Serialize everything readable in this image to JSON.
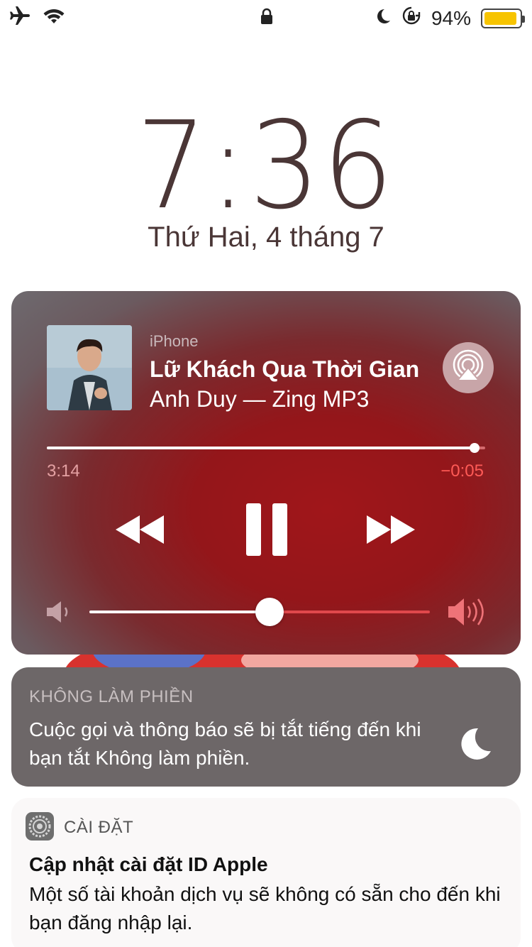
{
  "status_bar": {
    "icons": [
      "airplane-icon",
      "wifi-icon",
      "lock-icon",
      "moon-icon",
      "rotation-lock-icon"
    ],
    "battery_percent": "94%",
    "battery_level": 0.94,
    "battery_color": "#f7c400"
  },
  "lock_screen": {
    "time": "7:36",
    "date": "Thứ Hai, 4 tháng 7"
  },
  "now_playing": {
    "source": "iPhone",
    "title": "Lữ Khách Qua Thời Gian",
    "artist_line": "Anh Duy — Zing MP3",
    "elapsed": "3:14",
    "remaining": "−0:05",
    "progress": 0.975,
    "volume": 0.53,
    "accent_color": "#9b1418",
    "controls": [
      "rewind-icon",
      "pause-icon",
      "fast-forward-icon"
    ],
    "airplay_icon": "airplay-icon"
  },
  "do_not_disturb": {
    "header": "KHÔNG LÀM PHIỀN",
    "message": "Cuộc gọi và thông báo sẽ bị tắt tiếng đến khi bạn tắt Không làm phiền.",
    "icon": "moon-icon"
  },
  "notification": {
    "app_name": "CÀI ĐẶT",
    "app_icon": "settings-gear-icon",
    "title": "Cập nhật cài đặt ID Apple",
    "body": "Một số tài khoản dịch vụ sẽ không có sẵn cho đến khi bạn đăng nhập lại."
  }
}
